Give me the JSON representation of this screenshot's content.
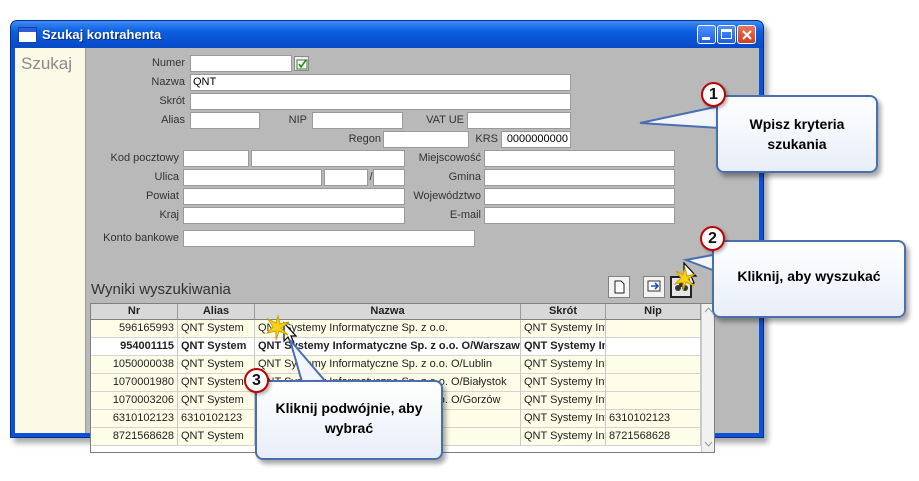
{
  "window": {
    "title": "Szukaj kontrahenta",
    "side_label": "Szukaj"
  },
  "form": {
    "numer_label": "Numer",
    "numer_value": "",
    "nazwa_label": "Nazwa",
    "nazwa_value": "QNT",
    "skrot_label": "Skrót",
    "alias_label": "Alias",
    "nip_label": "NIP",
    "vatue_label": "VAT UE",
    "regon_label": "Regon",
    "krs_label": "KRS",
    "krs_value": "0000000000",
    "kod_label": "Kod pocztowy",
    "miejscowosc_label": "Miejscowość",
    "ulica_label": "Ulica",
    "ulica_sep": "/",
    "gmina_label": "Gmina",
    "powiat_label": "Powiat",
    "wojewodztwo_label": "Województwo",
    "kraj_label": "Kraj",
    "email_label": "E-mail",
    "konto_label": "Konto bankowe"
  },
  "results": {
    "label": "Wyniki wyszukiwania",
    "columns": [
      "Nr",
      "Alias",
      "Nazwa",
      "Skrót",
      "Nip"
    ],
    "rows": [
      {
        "nr": "596165993",
        "alias": "QNT System",
        "nazwa": "QNT Systemy Informatyczne Sp. z o.o.",
        "skrot": "QNT Systemy Inf",
        "nip": ""
      },
      {
        "nr": "954001115",
        "alias": "QNT System",
        "nazwa": "QNT Systemy Informatyczne Sp. z o.o. O/Warszaw",
        "skrot": "QNT Systemy In",
        "nip": ""
      },
      {
        "nr": "1050000038",
        "alias": "QNT System",
        "nazwa": "QNT Systemy Informatyczne Sp. z o.o. O/Lublin",
        "skrot": "QNT Systemy Inf",
        "nip": ""
      },
      {
        "nr": "1070001980",
        "alias": "QNT System",
        "nazwa": "QNT Systemy Informatyczne Sp. z o.o. O/Białystok",
        "skrot": "QNT Systemy Inf",
        "nip": ""
      },
      {
        "nr": "1070003206",
        "alias": "QNT System",
        "nazwa": "QNT Systemy Informatyczne Sp. z o.o. O/Gorzów",
        "skrot": "QNT Systemy Inf",
        "nip": ""
      },
      {
        "nr": "6310102123",
        "alias": "6310102123",
        "nazwa": "",
        "skrot": "QNT Systemy Inf",
        "nip": "6310102123"
      },
      {
        "nr": "8721568628",
        "alias": "QNT System",
        "nazwa": "",
        "skrot": "QNT Systemy Inf",
        "nip": "8721568628"
      }
    ]
  },
  "callouts": {
    "c1_num": "1",
    "c1_text": "Wpisz kryteria szukania",
    "c2_num": "2",
    "c2_text": "Kliknij, aby wyszukać",
    "c3_num": "3",
    "c3_text": "Kliknij podwójnie, aby wybrać"
  },
  "colors": {
    "titlebar": "#0a5ee0",
    "client_bg": "#b9b9b9",
    "row_bg": "#fdfde8",
    "callout_border": "#4a6fb0",
    "badge_border": "#c00000"
  },
  "icons": [
    "window-icon",
    "minimize-icon",
    "maximize-icon",
    "close-icon",
    "checklist-icon",
    "new-document-icon",
    "export-icon",
    "search-binoculars-icon",
    "cursor-icon"
  ]
}
